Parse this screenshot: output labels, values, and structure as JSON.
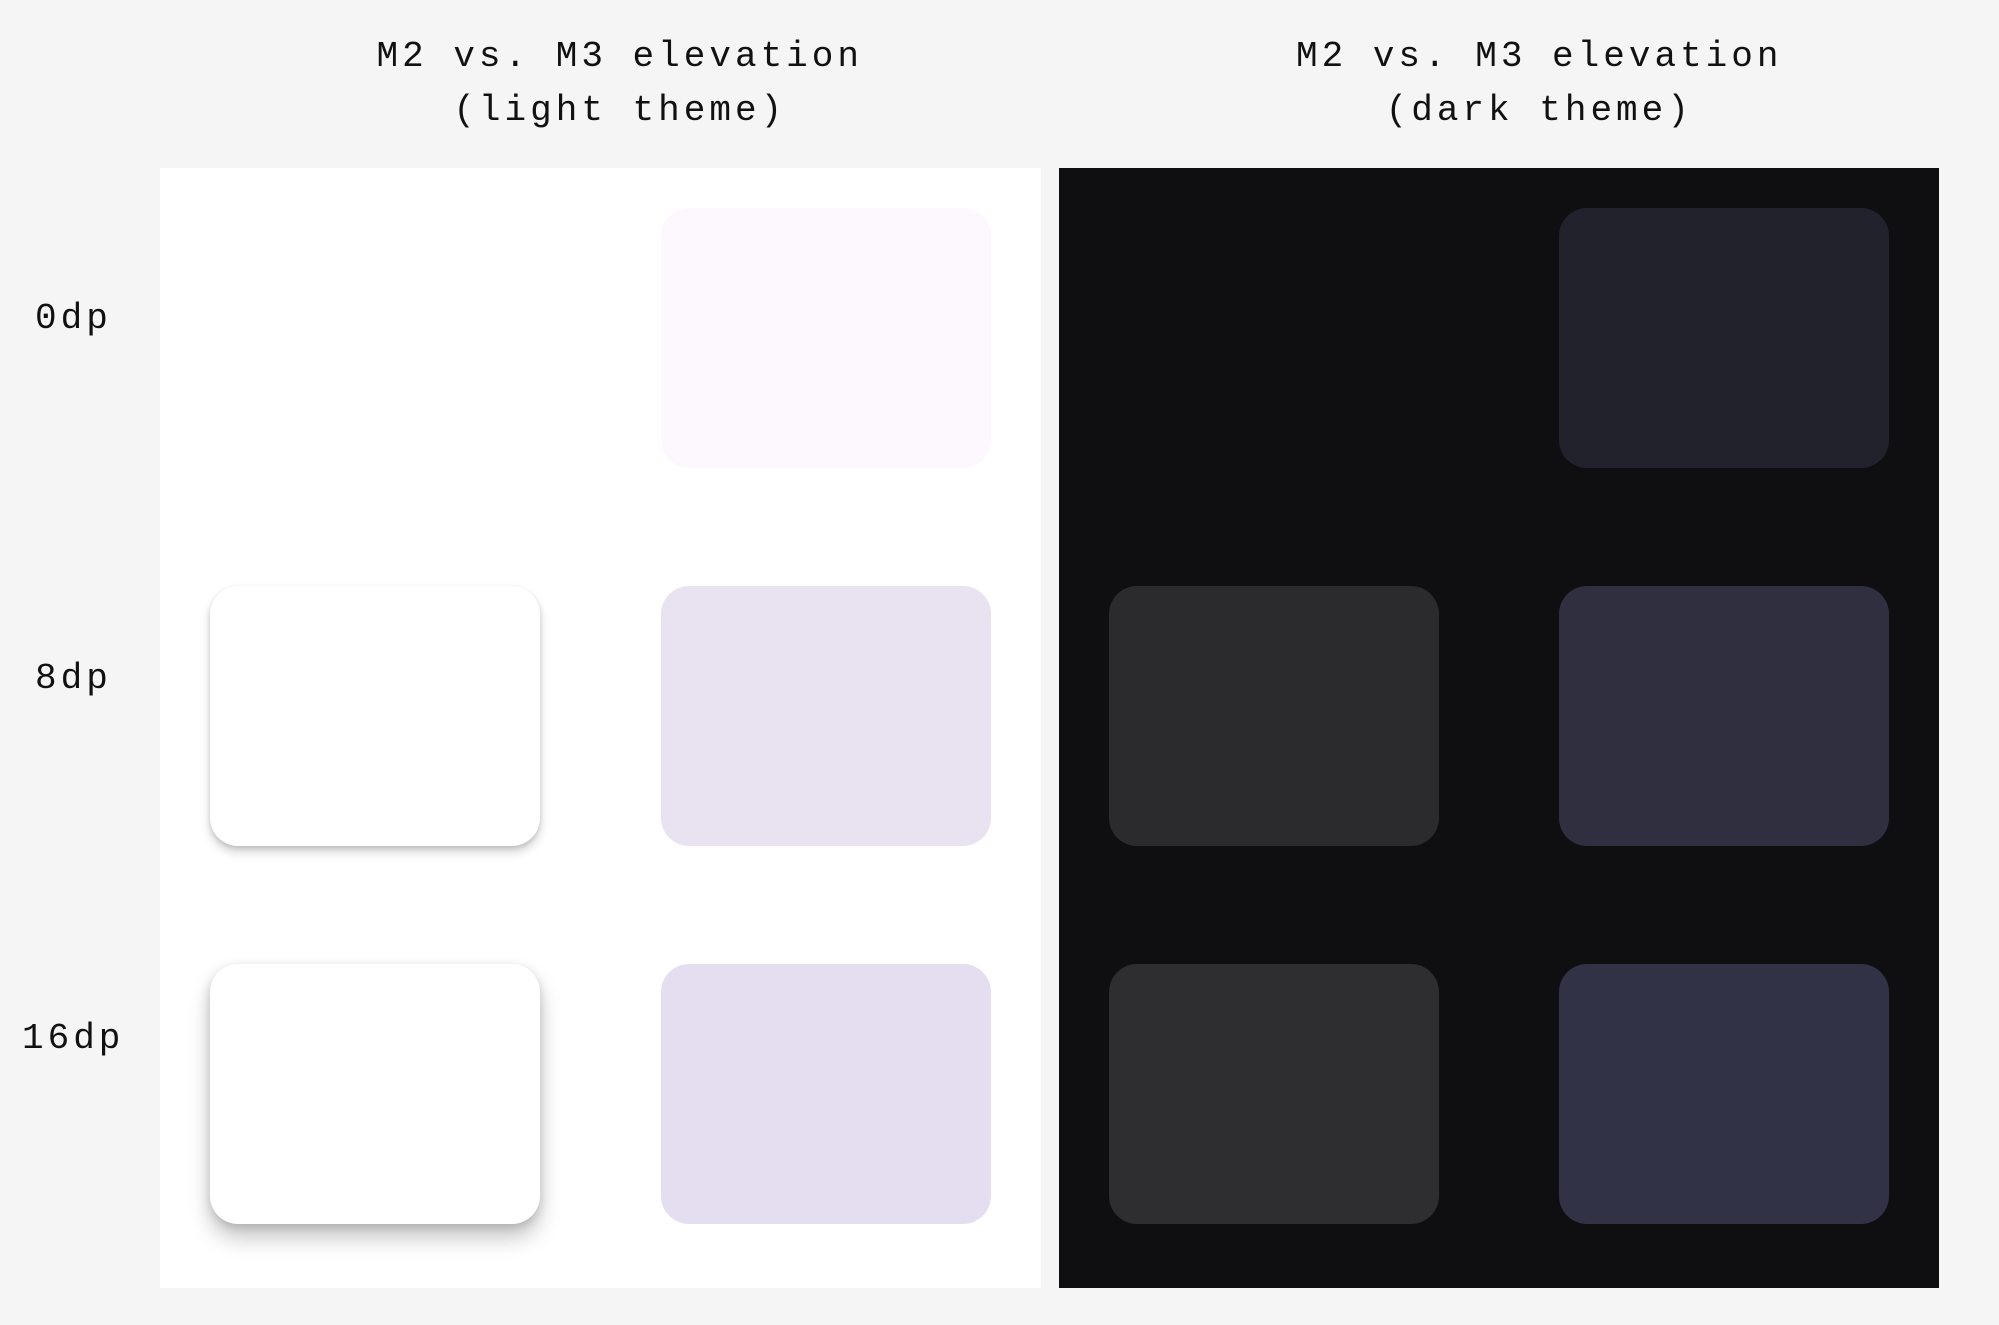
{
  "headers": {
    "light": {
      "line1": "M2 vs. M3 elevation",
      "line2": "(light theme)"
    },
    "dark": {
      "line1": "M2 vs. M3 elevation",
      "line2": "(dark theme)"
    }
  },
  "rows": [
    {
      "label": "0dp"
    },
    {
      "label": "8dp"
    },
    {
      "label": "16dp"
    }
  ],
  "swatches": {
    "light": {
      "panel_bg": "#ffffff",
      "m2": {
        "bg0": "#ffffff",
        "bg8": "#ffffff",
        "bg16": "#ffffff",
        "shadow0": "none",
        "shadow8": "shadow-8",
        "shadow16": "shadow-16"
      },
      "m3": {
        "bg0": "#fdf8fd",
        "bg8": "#e9e2f1",
        "bg16": "#e5def0"
      }
    },
    "dark": {
      "panel_bg": "#0f0f12",
      "m2": {
        "bg0": "#0f0f12",
        "bg8": "#2b2b2e",
        "bg16": "#2e2e31"
      },
      "m3": {
        "bg0": "#22222c",
        "bg8": "#2f2f3f",
        "bg16": "#323247"
      }
    }
  },
  "chart_data": {
    "type": "table",
    "title": "M2 vs. M3 elevation surface colors",
    "columns": [
      "elevation(dp)",
      "light_m2_bg",
      "light_m2_shadow",
      "light_m3_bg",
      "dark_m2_bg",
      "dark_m3_bg"
    ],
    "rows": [
      [
        0,
        "#ffffff",
        "none",
        "#fdf8fd",
        "#0f0f12",
        "#22222c"
      ],
      [
        8,
        "#ffffff",
        "0 6px 10px rgba(0,0,0,0.18)",
        "#e9e2f1",
        "#2b2b2e",
        "#2f2f3f"
      ],
      [
        16,
        "#ffffff",
        "0 14px 22px rgba(0,0,0,0.22)",
        "#e5def0",
        "#2e2e31",
        "#323247"
      ]
    ]
  }
}
